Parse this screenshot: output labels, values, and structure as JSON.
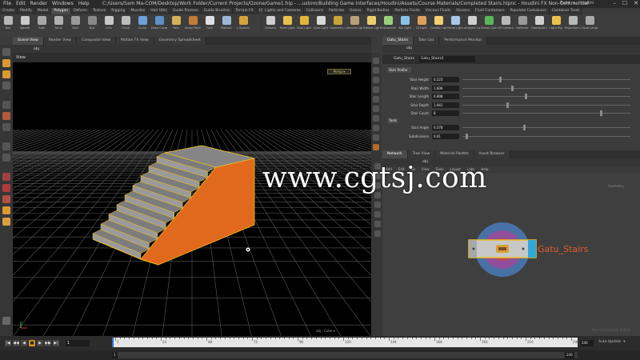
{
  "window": {
    "title": "C:/Users/Sam Ma-COM/Desktop/Work Folder/Current Projects/Ozone/Game1.hip - ...ustom/Building Game Interfaces/Houdini/Assets/Course Materials/Completed Stairs.hipnc - Houdini FX Non-Commercial",
    "menus": [
      "File",
      "Edit",
      "Render",
      "Windows",
      "Help"
    ],
    "right_tools": [
      "Build",
      "▾",
      "Houdini"
    ],
    "controls": [
      "–",
      "☐",
      "✕"
    ]
  },
  "shelf_left": {
    "tabs": [
      "Create",
      "Modify",
      "Model",
      "Polygon",
      "Deform",
      "Texture",
      "Rigging",
      "Muscles",
      "Hair Utils",
      "Guide Process",
      "Guide Brushes",
      "Terrain FX",
      "Cloud FX",
      "Volume"
    ],
    "active_tab": "Polygon",
    "tools": [
      {
        "label": "Box",
        "color": "#b8b8b8"
      },
      {
        "label": "Sphere",
        "color": "#c9c9c9"
      },
      {
        "label": "Tube",
        "color": "#a9a9a9"
      },
      {
        "label": "Torus",
        "color": "#b0b0b0"
      },
      {
        "label": "Grid",
        "color": "#9a9a9a"
      },
      {
        "label": "Null",
        "color": "#888888"
      },
      {
        "label": "Line",
        "color": "#c8c8c8"
      },
      {
        "label": "Circle",
        "color": "#bdbdbd"
      },
      {
        "label": "Curve",
        "color": "#6fa0d8"
      },
      {
        "label": "Draw Curve",
        "color": "#5d8fc8"
      },
      {
        "label": "Path",
        "color": "#d8b05a"
      },
      {
        "label": "Spray Paint",
        "color": "#c27b3a"
      },
      {
        "label": "Font",
        "color": "#e0e0e0"
      },
      {
        "label": "Platonic",
        "color": "#9fb7d6"
      },
      {
        "label": "L-System",
        "color": "#d6a33a"
      },
      {
        "label": "Metaball",
        "color": "#8ea7c6"
      },
      {
        "label": "File",
        "color": "#aaaaaa"
      }
    ]
  },
  "shelf_right": {
    "tabs": [
      "Lights and Cameras",
      "Collisions",
      "Particles",
      "Grains",
      "Rigid Bodies",
      "Particle Fluids",
      "Viscous Fluids",
      "Oceans",
      "Fluid Containers",
      "Populate Containers",
      "Container Tools",
      "Pyro FX",
      "Cloth",
      "Solid",
      "Wires",
      "Crowds",
      "Drive Simulation"
    ],
    "tools": [
      {
        "label": "Camera",
        "color": "#cfcfcf"
      },
      {
        "label": "Point Light",
        "color": "#e8c24a"
      },
      {
        "label": "Spot Light",
        "color": "#e0b63a"
      },
      {
        "label": "Area Light",
        "color": "#d8d8d8"
      },
      {
        "label": "Geometry Light",
        "color": "#c8a23a"
      },
      {
        "label": "Volume Light",
        "color": "#b8a07a"
      },
      {
        "label": "Distant Light",
        "color": "#e8d06a"
      },
      {
        "label": "Environment Light",
        "color": "#9ad07a"
      },
      {
        "label": "Sky Light",
        "color": "#8ac0e8"
      },
      {
        "label": "GI Light",
        "color": "#e0a05a"
      },
      {
        "label": "Caustic Light",
        "color": "#f0d070"
      },
      {
        "label": "Portal Light",
        "color": "#a8c8e8"
      },
      {
        "label": "Ambient Light",
        "color": "#cfcfcf"
      },
      {
        "label": "Stereo Camera",
        "color": "#58b858"
      },
      {
        "label": "VR Camera",
        "color": "#b8b8b8"
      },
      {
        "label": "Switcher",
        "color": "#9a9a9a"
      },
      {
        "label": "Gamepad Camera",
        "color": "#cfcfcf"
      },
      {
        "label": "Light Rig",
        "color": "#e8c24a"
      },
      {
        "label": "Projection Cam",
        "color": "#b8b8b8"
      },
      {
        "label": "Focal Length",
        "color": "#a8a8a8"
      }
    ]
  },
  "viewport_tabs": [
    "Scene View",
    "Render View",
    "Composite View",
    "Motion FX View",
    "Geometry Spreadsheet"
  ],
  "viewport": {
    "path": "obj",
    "title": "View",
    "camera_menu": "Persp ▾",
    "status": "obj - Cube ▾"
  },
  "param_tabs": [
    "Gatu_Stairs",
    "Take List",
    "Performance Monitor"
  ],
  "params": {
    "path": "obj",
    "node_type": "Gatu_Stairs",
    "node_name": "Gatu_Stairs1",
    "folder1": "Stair Profile",
    "folder2": "Tools",
    "rows": [
      {
        "label": "Stair Height",
        "value": "0.223",
        "knob": 0.22
      },
      {
        "label": "Stair Width",
        "value": "1.606",
        "knob": 0.29
      },
      {
        "label": "Stair Length",
        "value": "0.808",
        "knob": 0.37
      },
      {
        "label": "Stair Depth",
        "value": "1.941",
        "knob": 0.26
      },
      {
        "label": "Stair Count",
        "value": "8",
        "knob": 0.82
      }
    ],
    "rows2": [
      {
        "label": "Stair Angle",
        "value": "0.378",
        "knob": 0.36
      },
      {
        "label": "Subdivisions",
        "value": "0.01",
        "knob": 0.02
      }
    ]
  },
  "network_tabs": [
    "Network",
    "Tree View",
    "Material Palette",
    "Asset Browser"
  ],
  "network": {
    "path": "obj",
    "menu": [
      "Add",
      "Edit",
      "Go",
      "View",
      "Tools",
      "Layout",
      "Labs",
      "Help"
    ],
    "node_label": "Gatu_Stairs",
    "corner_label": "Non-Commercial Edition",
    "badge": "Geometry"
  },
  "timeline": {
    "controls": [
      "|◀",
      "◀◀",
      "◀",
      "■",
      "▶",
      "▶▶",
      "▶|"
    ],
    "frame": "1",
    "end": "240",
    "ticks": [
      "1",
      "24",
      "48",
      "72",
      "96",
      "120",
      "144",
      "168",
      "192",
      "216",
      "240"
    ],
    "range_start": "1",
    "range_end": "240",
    "right_labels": [
      "Auto Update",
      "▾"
    ]
  },
  "watermark": "www.cgtsj.com",
  "colors": {
    "accent": "#e0691e",
    "selection": "#f0c020",
    "node_blue": "#34a6d8"
  }
}
